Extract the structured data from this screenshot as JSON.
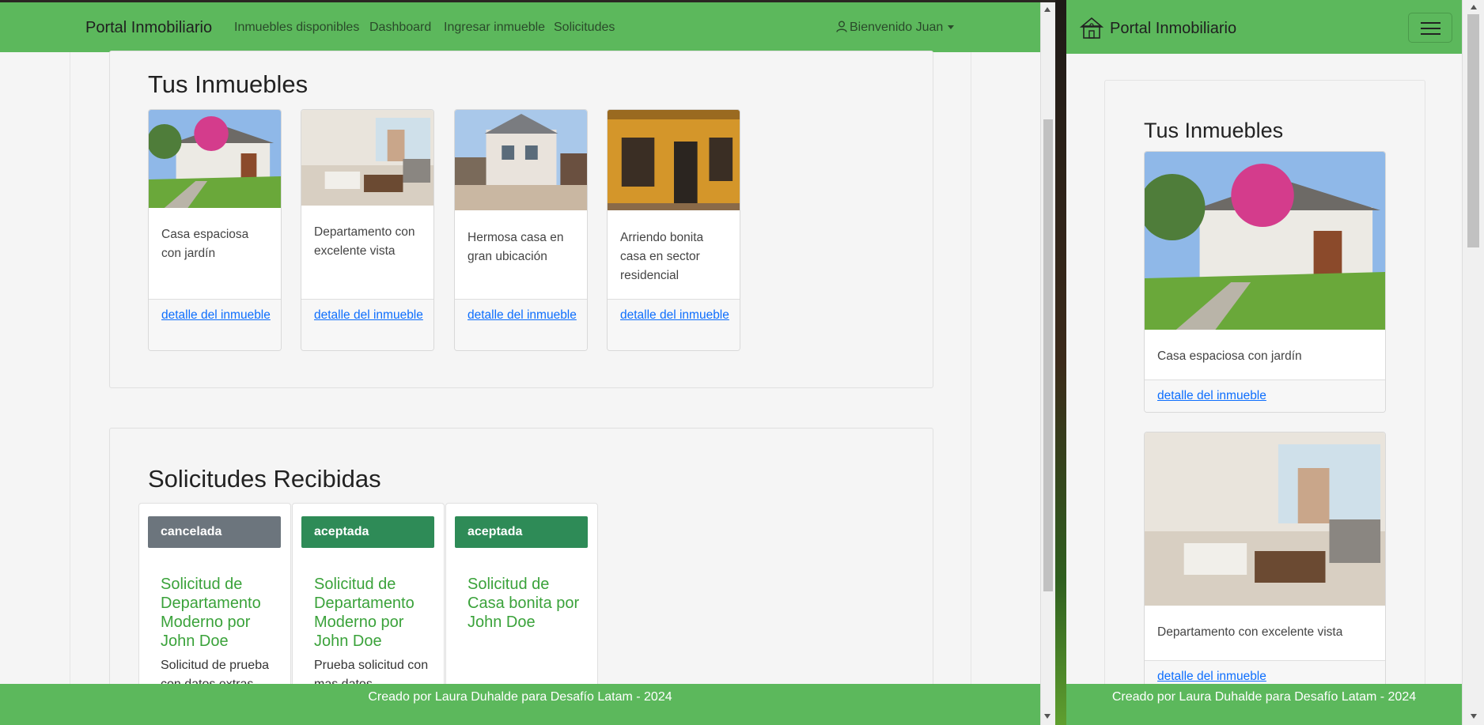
{
  "left": {
    "brand": "Portal Inmobiliario",
    "nav": [
      "Inmuebles disponibles",
      "Dashboard",
      "Ingresar inmueble",
      "Solicitudes"
    ],
    "user_menu": "Bienvenido Juan",
    "properties_title": "Tus Inmuebles",
    "properties": [
      {
        "text": "Casa espaciosa con jardín",
        "link": "detalle del inmueble"
      },
      {
        "text": "Departamento con excelente vista",
        "link": "detalle del inmueble"
      },
      {
        "text": "Hermosa casa en gran ubicación",
        "link": "detalle del inmueble"
      },
      {
        "text": "Arriendo bonita casa en sector residencial",
        "link": "detalle del inmueble"
      }
    ],
    "requests_title": "Solicitudes Recibidas",
    "requests": [
      {
        "status": "cancelada",
        "title": "Solicitud de Departamento Moderno por John Doe",
        "text": "Solicitud de prueba con datos extras"
      },
      {
        "status": "aceptada",
        "title": "Solicitud de Departamento Moderno por John Doe",
        "text": "Prueba solicitud con mas datos"
      },
      {
        "status": "aceptada",
        "title": "Solicitud de Casa bonita por John Doe",
        "text": ""
      }
    ],
    "footer": "Creado por Laura Duhalde para Desafío Latam - 2024"
  },
  "right": {
    "brand": "Portal Inmobiliario",
    "properties_title": "Tus Inmuebles",
    "properties": [
      {
        "text": "Casa espaciosa con jardín",
        "link": "detalle del inmueble"
      },
      {
        "text": "Departamento con excelente vista",
        "link": "detalle del inmueble"
      }
    ],
    "footer": "Creado por Laura Duhalde para Desafío Latam - 2024"
  },
  "colors": {
    "navbar": "#5cb85c",
    "status_cancelada": "#6c757d",
    "status_aceptada": "#2e8b57",
    "link": "#0d6efd",
    "request_title": "#3aa23a"
  },
  "icons": [
    "user-icon",
    "caret-down-icon",
    "house-logo-icon",
    "hamburger-icon"
  ]
}
